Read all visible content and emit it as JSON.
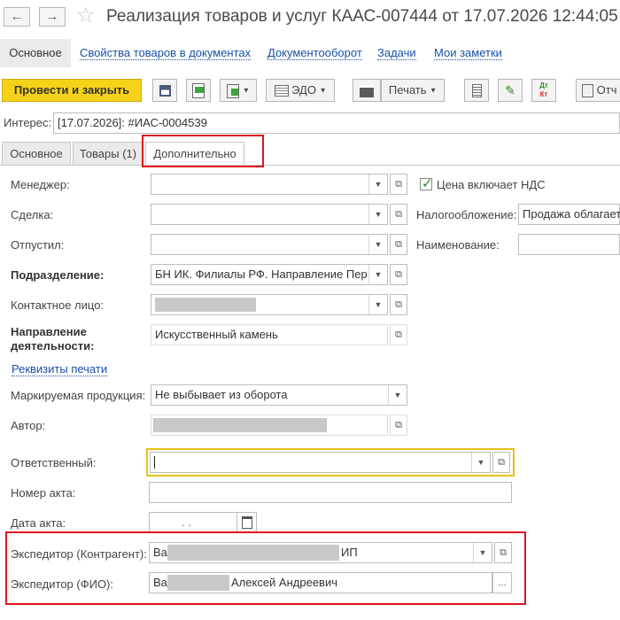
{
  "title": "Реализация товаров и услуг КААС-007444 от 17.07.2026 12:44:05",
  "section_nav": {
    "active": "Основное",
    "links": [
      "Свойства товаров в документах",
      "Документооборот",
      "Задачи",
      "Мои заметки"
    ]
  },
  "toolbar": {
    "post_close": "Провести и закрыть",
    "edo": "ЭДО",
    "print": "Печать",
    "report": "Отч",
    "dt_kt_top": "Дт",
    "dt_kt_bottom": "Кт"
  },
  "interest": {
    "label": "Интерес:",
    "value": "[17.07.2026]: #ИАС-0004539"
  },
  "tabs": [
    "Основное",
    "Товары (1)",
    "Дополнительно"
  ],
  "form": {
    "manager_label": "Менеджер:",
    "deal_label": "Сделка:",
    "released_label": "Отпустил:",
    "division_label": "Подразделение:",
    "division_value": "БН ИК. Филиалы РФ. Направление Пер",
    "contact_label": "Контактное лицо:",
    "direction_label_1": "Направление",
    "direction_label_2": "деятельности:",
    "direction_value": "Искусственный камень",
    "print_details_link": "Реквизиты печати",
    "marked_label": "Маркируемая продукция:",
    "marked_value": "Не выбывает из оборота",
    "author_label": "Автор:",
    "responsible_label": "Ответственный:",
    "act_number_label": "Номер акта:",
    "act_date_label": "Дата акта:",
    "act_date_value": ". .",
    "forwarder_contractor_label": "Экспедитор (Контрагент):",
    "forwarder_contractor_prefix": "Ва",
    "forwarder_contractor_suffix": "ИП",
    "forwarder_name_label": "Экспедитор (ФИО):",
    "forwarder_name_prefix": "Ва",
    "forwarder_name_suffix": "Алексей Андреевич",
    "vat_included_label": "Цена включает НДС",
    "vat_included_checked": true,
    "taxation_label": "Налогообложение:",
    "taxation_value": "Продажа облагается",
    "name_label": "Наименование:"
  },
  "colors": {
    "primary_button": "#f5d21a",
    "highlight_border": "#e0141e",
    "focus_border": "#e3c21a",
    "link": "#1a4fa8"
  }
}
